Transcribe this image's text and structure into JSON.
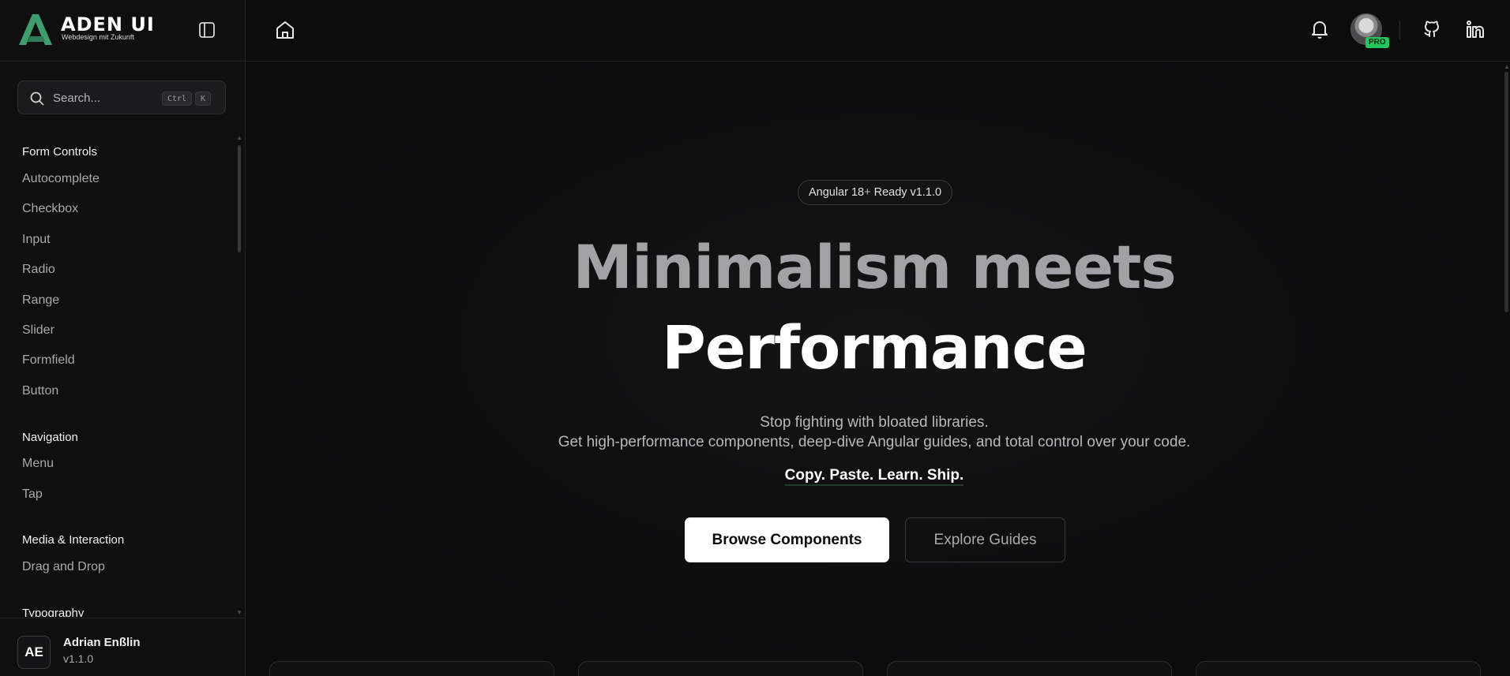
{
  "brand": {
    "name": "ADEN UI",
    "tagline": "Webdesign mit Zukunft",
    "logo_icon": "aden-logo-icon",
    "accent_color": "#3f9d6e"
  },
  "search": {
    "placeholder": "Search...",
    "shortcut_modifier": "Ctrl",
    "shortcut_key": "K"
  },
  "sidebar": {
    "sections": [
      {
        "title": "Form Controls",
        "items": [
          "Autocomplete",
          "Checkbox",
          "Input",
          "Radio",
          "Range",
          "Slider",
          "Formfield",
          "Button"
        ]
      },
      {
        "title": "Navigation",
        "items": [
          "Menu",
          "Tap"
        ]
      },
      {
        "title": "Media & Interaction",
        "items": [
          "Drag and Drop"
        ]
      },
      {
        "title": "Typography",
        "items": []
      }
    ]
  },
  "user": {
    "initials": "AE",
    "name": "Adrian Enßlin",
    "version": "v1.1.0"
  },
  "topbar": {
    "home_icon": "home-icon",
    "notification_icon": "bell-icon",
    "profile_badge": "PRO",
    "github_icon": "github-icon",
    "linkedin_icon": "linkedin-icon"
  },
  "hero": {
    "version_pill": {
      "framework": "Angular 18",
      "plus": "+",
      "status": "Ready v1.1.0"
    },
    "headline_line1": "Minimalism meets",
    "headline_line2": "Performance",
    "subtitle_line1": "Stop fighting with bloated libraries.",
    "subtitle_line2": "Get high-performance components, deep-dive Angular guides, and total control over your code.",
    "tagline": "Copy. Paste. Learn. Ship.",
    "primary_button": "Browse Components",
    "secondary_button": "Explore Guides"
  },
  "colors": {
    "background": "#0c0c0d",
    "pro_badge": "#22c55e"
  }
}
